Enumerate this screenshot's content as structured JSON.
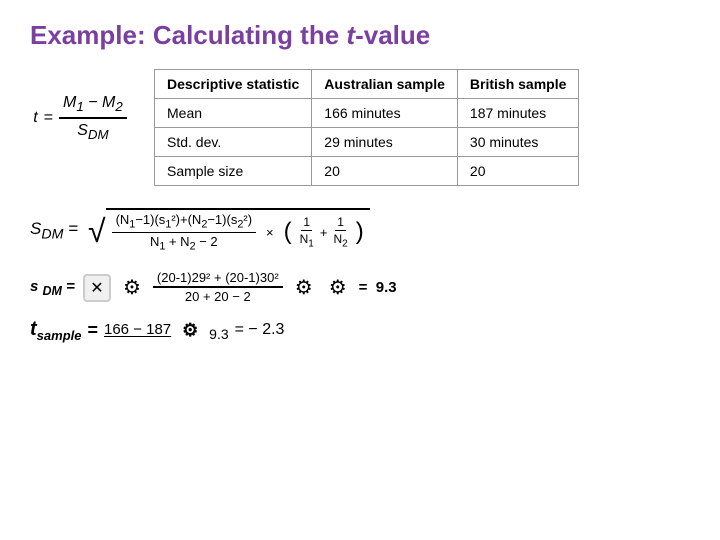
{
  "title": {
    "prefix": "Example: Calculating the ",
    "italic_char": "t",
    "suffix": "-value"
  },
  "table": {
    "headers": [
      "Descriptive statistic",
      "Australian sample",
      "British sample"
    ],
    "rows": [
      [
        "Mean",
        "166 minutes",
        "187 minutes"
      ],
      [
        "Std. dev.",
        "29 minutes",
        "30 minutes"
      ],
      [
        "Sample size",
        "20",
        "20"
      ]
    ]
  },
  "formulas": {
    "t_label": "t =",
    "sdm_label": "S",
    "sdm_sub": "DM",
    "sdm_equals": "=",
    "sdm_calc_label": "S DM =",
    "sdm_calc_numer": "(20-1)29² + (20-1)30²",
    "sdm_calc_denom": "20 + 20 − 2",
    "sdm_calc_result": "= 9.3",
    "tsample_label": "t",
    "tsample_sub": "sample",
    "tsample_equals": "=",
    "tsample_numer": "166 − 187",
    "tsample_denom": "9.3",
    "tsample_result": "= − 2.3"
  }
}
